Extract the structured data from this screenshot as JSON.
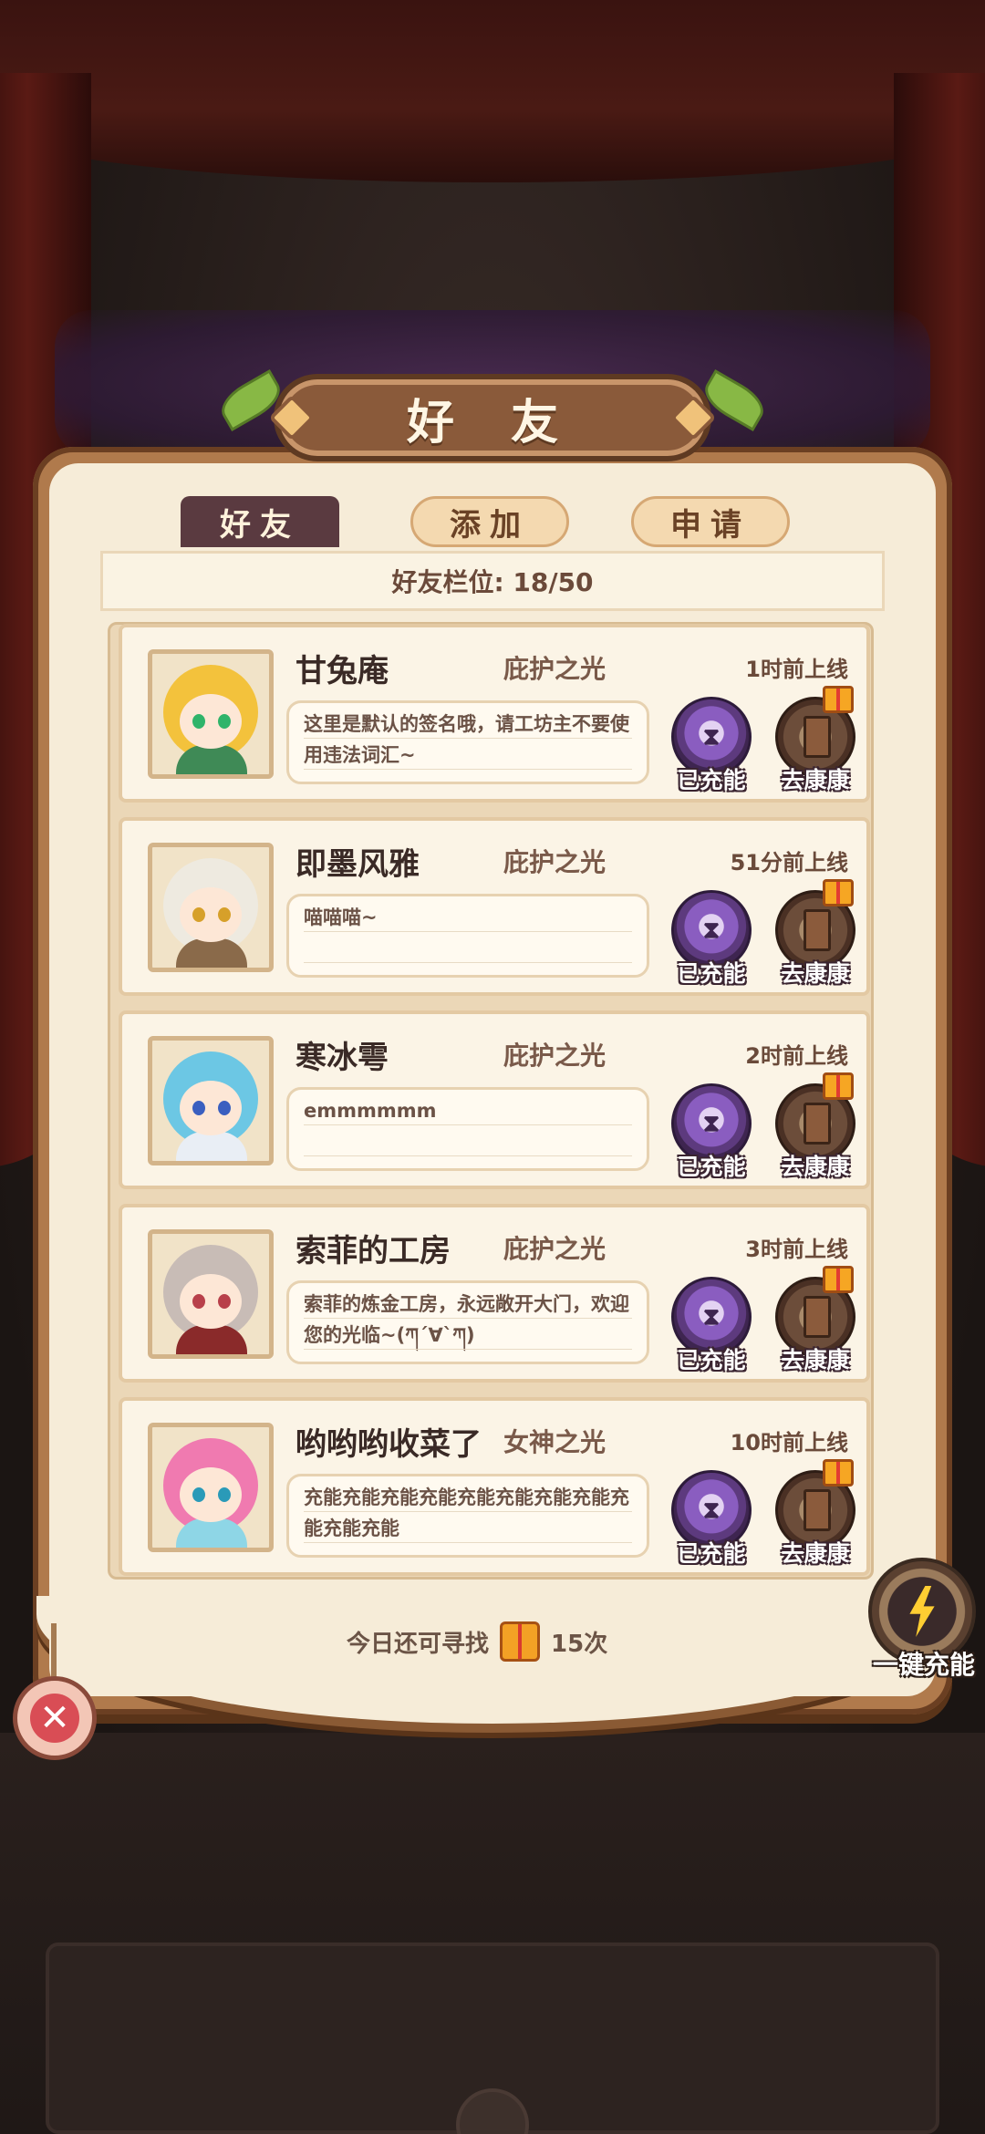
{
  "dialog": {
    "title": "好 友",
    "tabs": [
      {
        "label": "好友",
        "active": true
      },
      {
        "label": "添加",
        "active": false
      },
      {
        "label": "申请",
        "active": false
      }
    ],
    "slot_text": "好友栏位: 18/50"
  },
  "friends": [
    {
      "name": "甘兔庵",
      "tag": "庇护之光",
      "last_online": "1时前上线",
      "signature": "这里是默认的签名哦，请工坊主不要使用违法词汇~",
      "charge_label": "已充能",
      "heal_label": "去康康",
      "hair_color": "#f3c23c",
      "eye_color": "#2fb46a",
      "body_color": "#3f8a56"
    },
    {
      "name": "即墨风雅",
      "tag": "庇护之光",
      "last_online": "51分前上线",
      "signature": "喵喵喵~",
      "charge_label": "已充能",
      "heal_label": "去康康",
      "hair_color": "#eeeae0",
      "eye_color": "#d6a02a",
      "body_color": "#8a6a4a"
    },
    {
      "name": "寒冰雩",
      "tag": "庇护之光",
      "last_online": "2时前上线",
      "signature": "emmmmmm",
      "charge_label": "已充能",
      "heal_label": "去康康",
      "hair_color": "#6cc7e4",
      "eye_color": "#3a5fc0",
      "body_color": "#e9eef5"
    },
    {
      "name": "索菲的工房",
      "tag": "庇护之光",
      "last_online": "3时前上线",
      "signature": "索菲的炼金工房，永远敞开大门，欢迎您的光临~(ཀ´∀`ཀ)",
      "charge_label": "已充能",
      "heal_label": "去康康",
      "hair_color": "#c8bcb6",
      "eye_color": "#b8404a",
      "body_color": "#8a2a2a"
    },
    {
      "name": "哟哟哟收菜了",
      "tag": "女神之光",
      "last_online": "10时前上线",
      "signature": "充能充能充能充能充能充能充能充能充能充能充能",
      "charge_label": "已充能",
      "heal_label": "去康康",
      "hair_color": "#f07ab0",
      "eye_color": "#2a9ab8",
      "body_color": "#8ed6e6"
    }
  ],
  "footer": {
    "search_prefix": "今日还可寻找",
    "search_count": "15次",
    "charge_all_label": "一键充能"
  },
  "icons": {
    "close": "close-icon",
    "bolt": "lightning-icon",
    "gift": "gift-icon",
    "charge": "hourglass-icon",
    "heal": "door-icon"
  }
}
